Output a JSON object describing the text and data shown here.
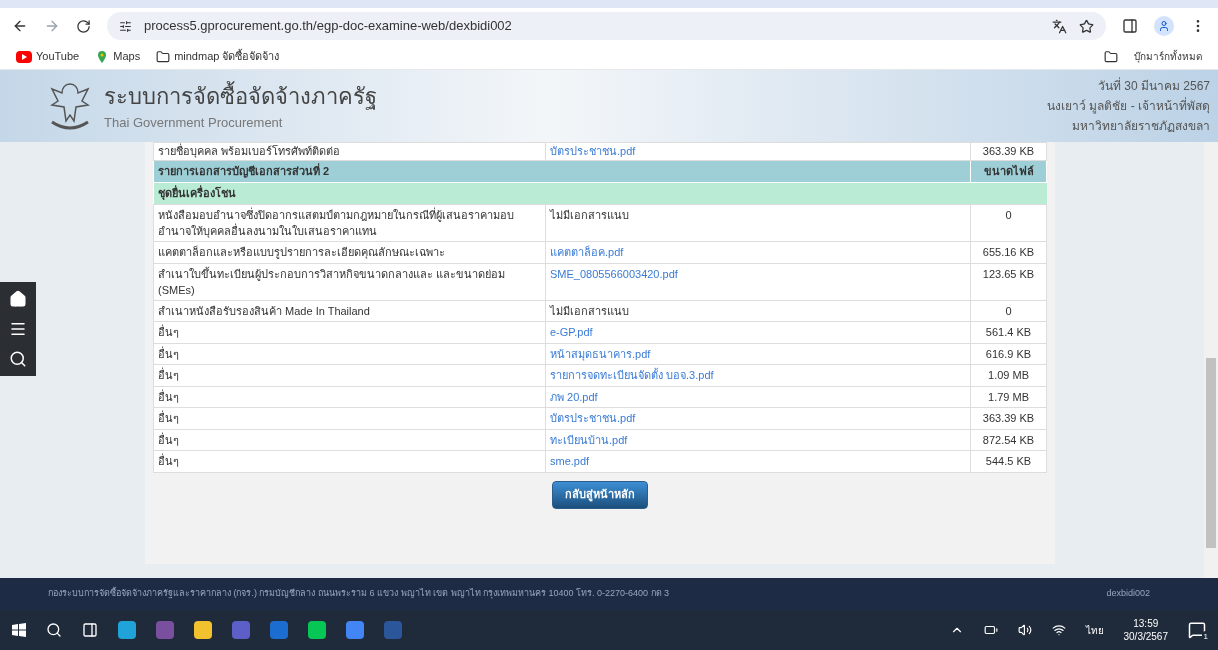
{
  "browser": {
    "url": "process5.gprocurement.go.th/egp-doc-examine-web/dexbidi002",
    "bookmarks": [
      {
        "label": "YouTube",
        "kind": "youtube"
      },
      {
        "label": "Maps",
        "kind": "maps"
      },
      {
        "label": "mindmap จัดซื้อจัดจ้าง",
        "kind": "folder"
      }
    ],
    "all_bookmarks": "บุ๊กมาร์กทั้งหมด"
  },
  "header": {
    "title": "ระบบการจัดซื้อจัดจ้างภาครัฐ",
    "subtitle": "Thai Government Procurement",
    "date": "วันที่ 30 มีนาคม 2567",
    "user": "นงเยาว์ มูลติชัย - เจ้าหน้าที่พัสดุ",
    "org": "มหาวิทยาลัยราชภัฏสงขลา"
  },
  "table": {
    "previous_row": {
      "document": "รายชื่อบุคคล พร้อมเบอร์โทรศัพท์ติดต่อ",
      "file": "บัตรประชาชน.pdf",
      "size": "363.39 KB"
    },
    "section_title": "รายการเอกสารบัญชีเอกสารส่วนที่ 2",
    "size_heading": "ขนาดไฟล์",
    "group": "ชุดยื่นเครื่องโชน",
    "rows": [
      {
        "document": "หนังสือมอบอำนาจซึ่งปิดอากรแสตมป์ตามกฎหมายในกรณีที่ผู้เสนอราคามอบอำนาจให้บุคคลอื่นลงนามในใบเสนอราคาแทน",
        "kind": "none",
        "file": "ไม่มีเอกสารแนบ",
        "size": "0"
      },
      {
        "document": "แคตตาล็อกและหรือแบบรูปรายการละเอียดคุณลักษณะเฉพาะ",
        "kind": "link",
        "file": "แคตตาล็อค.pdf",
        "size": "655.16 KB"
      },
      {
        "document": "สำเนาใบขึ้นทะเบียนผู้ประกอบการวิสาหกิจขนาดกลางและ และขนาดย่อม (SMEs)",
        "kind": "link",
        "file": "SME_0805566003420.pdf",
        "size": "123.65 KB"
      },
      {
        "document": "สำเนาหนังสือรับรองสินค้า Made In Thailand",
        "kind": "none",
        "file": "ไม่มีเอกสารแนบ",
        "size": "0"
      },
      {
        "document": "อื่นๆ",
        "kind": "link",
        "file": "e-GP.pdf",
        "size": "561.4 KB"
      },
      {
        "document": "อื่นๆ",
        "kind": "link",
        "file": "หน้าสมุดธนาคาร.pdf",
        "size": "616.9 KB"
      },
      {
        "document": "อื่นๆ",
        "kind": "link",
        "file": "รายการจดทะเบียนจัดตั้ง บอจ.3.pdf",
        "size": "1.09 MB"
      },
      {
        "document": "อื่นๆ",
        "kind": "link",
        "file": "ภพ 20.pdf",
        "size": "1.79 MB"
      },
      {
        "document": "อื่นๆ",
        "kind": "link",
        "file": "บัตรประชาชน.pdf",
        "size": "363.39 KB"
      },
      {
        "document": "อื่นๆ",
        "kind": "link",
        "file": "ทะเบียนบ้าน.pdf",
        "size": "872.54 KB"
      },
      {
        "document": "อื่นๆ",
        "kind": "link",
        "file": "sme.pdf",
        "size": "544.5 KB"
      }
    ]
  },
  "back_button": "กลับสู่หน้าหลัก",
  "footer": {
    "address": "กองระบบการจัดซื้อจัดจ้างภาครัฐและราคากลาง (กจร.) กรมบัญชีกลาง ถนนพระราม 6 แขวง พญาไท เขต พญาไท กรุงเทพมหานคร 10400 โทร. 0-2270-6400 กด 3",
    "page_code": "dexbidi002"
  },
  "taskbar": {
    "language": "ไทย",
    "time": "13:59",
    "date": "30/3/2567",
    "notifications": "1"
  }
}
